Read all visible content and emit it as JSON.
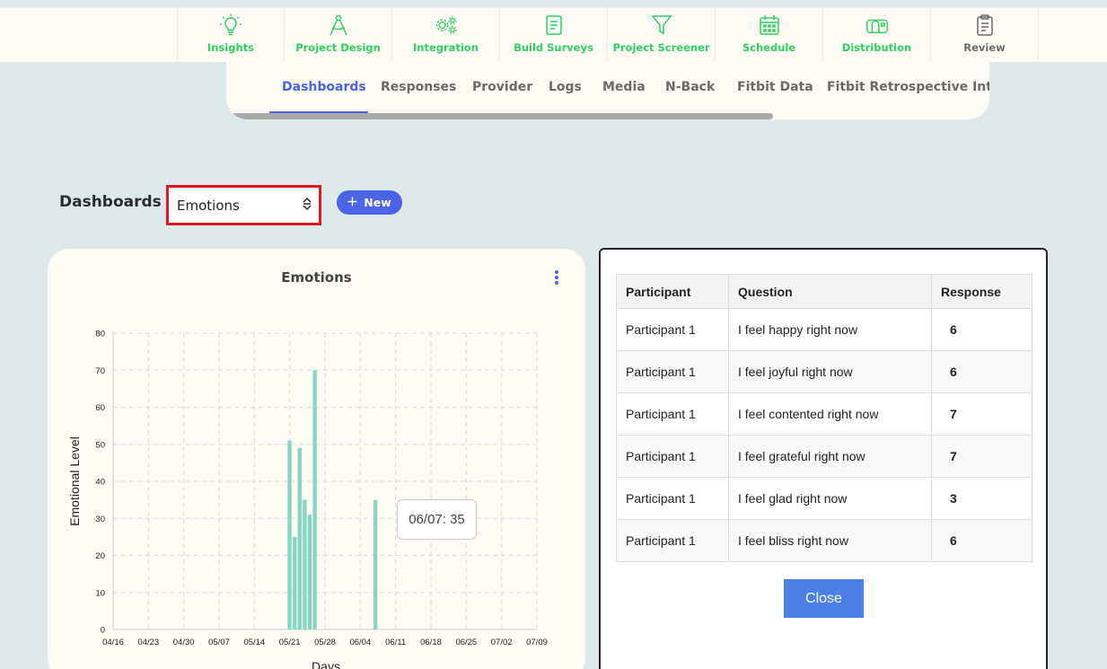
{
  "nav": {
    "items": [
      {
        "label": "Insights",
        "icon": "lightbulb-icon",
        "color": "#2fcf62"
      },
      {
        "label": "Project Design",
        "icon": "compass-icon",
        "color": "#2fcf62"
      },
      {
        "label": "Integration",
        "icon": "gears-icon",
        "color": "#2fcf62"
      },
      {
        "label": "Build Surveys",
        "icon": "form-icon",
        "color": "#2fcf62"
      },
      {
        "label": "Project Screener",
        "icon": "filter-icon",
        "color": "#2fcf62"
      },
      {
        "label": "Schedule",
        "icon": "calendar-icon",
        "color": "#2fcf62"
      },
      {
        "label": "Distribution",
        "icon": "mailbox-icon",
        "color": "#2fcf62"
      },
      {
        "label": "Review",
        "icon": "clipboard-icon",
        "color": "#6b6b6b"
      }
    ]
  },
  "tabs": [
    "Dashboards",
    "Responses",
    "Provider",
    "Logs",
    "Media",
    "N-Back",
    "Fitbit Data",
    "Fitbit Retrospective Intrad"
  ],
  "active_tab": "Dashboards",
  "header": {
    "title": "Dashboards",
    "selected_dashboard": "Emotions",
    "new_button": "New"
  },
  "chart_data": {
    "type": "bar",
    "title": "Emotions",
    "xlabel": "Days",
    "ylabel": "Emotional Level",
    "ylim": [
      0,
      80
    ],
    "y_ticks": [
      "0",
      "10",
      "20",
      "30",
      "40",
      "50",
      "60",
      "70",
      "80"
    ],
    "x_ticks": [
      "04/16",
      "04/23",
      "04/30",
      "05/07",
      "05/14",
      "05/21",
      "05/28",
      "06/04",
      "06/11",
      "06/18",
      "06/25",
      "07/02",
      "07/09"
    ],
    "x_dates": [
      "05/21",
      "05/22",
      "05/23",
      "05/24",
      "05/25",
      "05/26",
      "06/07"
    ],
    "values": [
      51,
      25,
      49,
      35,
      31,
      70,
      35
    ],
    "grid": true,
    "bar_color": "#84d6c5",
    "tooltip": "06/07: 35"
  },
  "table": {
    "headers": [
      "Participant",
      "Question",
      "Response"
    ],
    "rows": [
      [
        "Participant 1",
        "I feel happy right now",
        "6"
      ],
      [
        "Participant 1",
        "I feel joyful right now",
        "6"
      ],
      [
        "Participant 1",
        "I feel contented right now",
        "7"
      ],
      [
        "Participant 1",
        "I feel grateful right now",
        "7"
      ],
      [
        "Participant 1",
        "I feel glad right now",
        "3"
      ],
      [
        "Participant 1",
        "I feel bliss right now",
        "6"
      ]
    ],
    "close_label": "Close"
  },
  "colors": {
    "accent": "#4a63e7",
    "nav_green": "#2fcf62",
    "highlight": "#e3141d"
  }
}
